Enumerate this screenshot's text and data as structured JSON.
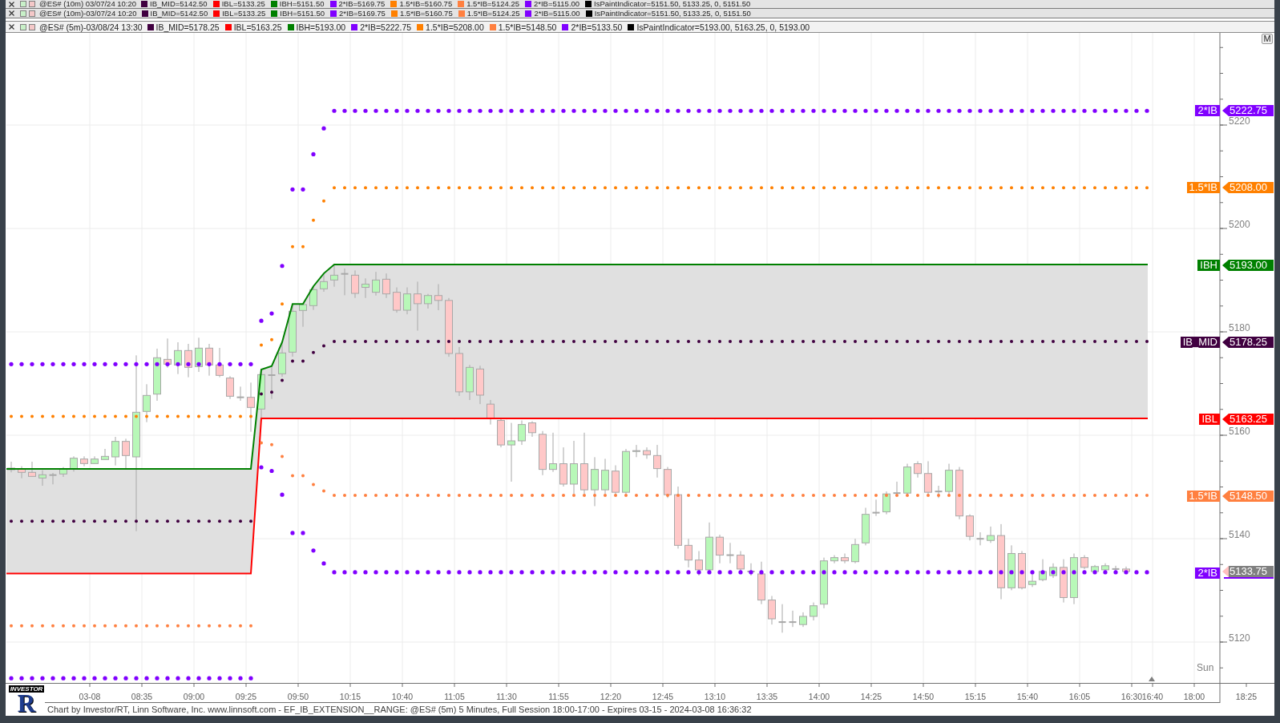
{
  "panes": [
    {
      "title": "@ES# (10m) 03/07/24 10:20",
      "legend": [
        {
          "text": "IB_MID=5142.50",
          "color": "#400040"
        },
        {
          "text": "IBL=5133.25",
          "color": "#ff0000"
        },
        {
          "text": "IBH=5151.50",
          "color": "#008000"
        },
        {
          "text": "2*IB=5169.75",
          "color": "#8000ff"
        },
        {
          "text": "1.5*IB=5160.75",
          "color": "#ff8000"
        },
        {
          "text": "1.5*IB=5124.25",
          "color": "#ff8040"
        },
        {
          "text": "2*IB=5115.00",
          "color": "#8000ff"
        },
        {
          "text": "IsPaintIndicator=5151.50, 5133.25, 0, 5151.50",
          "color": "#000000"
        }
      ]
    },
    {
      "title": "@ES# (10m)-03/07/24 10:20",
      "legend": [
        {
          "text": "IB_MID=5142.50",
          "color": "#400040"
        },
        {
          "text": "IBL=5133.25",
          "color": "#ff0000"
        },
        {
          "text": "IBH=5151.50",
          "color": "#008000"
        },
        {
          "text": "2*IB=5169.75",
          "color": "#8000ff"
        },
        {
          "text": "1.5*IB=5160.75",
          "color": "#ff8000"
        },
        {
          "text": "1.5*IB=5124.25",
          "color": "#ff8040"
        },
        {
          "text": "2*IB=5115.00",
          "color": "#8000ff"
        },
        {
          "text": "IsPaintIndicator=5151.50, 5133.25, 0, 5151.50",
          "color": "#000000"
        }
      ]
    }
  ],
  "chart": {
    "title": "@ES# (5m)-03/08/24 13:30",
    "legend": [
      {
        "text": "IB_MID=5178.25",
        "color": "#400040"
      },
      {
        "text": "IBL=5163.25",
        "color": "#ff0000"
      },
      {
        "text": "IBH=5193.00",
        "color": "#008000"
      },
      {
        "text": "2*IB=5222.75",
        "color": "#8000ff"
      },
      {
        "text": "1.5*IB=5208.00",
        "color": "#ff8000"
      },
      {
        "text": "1.5*IB=5148.50",
        "color": "#ff8040"
      },
      {
        "text": "2*IB=5133.50",
        "color": "#8000ff"
      },
      {
        "text": "IsPaintIndicator=5193.00, 5163.25, 0, 5193.00",
        "color": "#000000"
      }
    ],
    "axis_button": "M",
    "session_label": "Sun"
  },
  "price_axis": {
    "labels": [
      "5220",
      "5200",
      "5180",
      "5160",
      "5140",
      "5120"
    ]
  },
  "price_markers": [
    {
      "label": "2*IB",
      "value": "5222.75",
      "color": "#8000ff"
    },
    {
      "label": "1.5*IB",
      "value": "5208.00",
      "color": "#ff8000"
    },
    {
      "label": "IBH",
      "value": "5193.00",
      "color": "#008000"
    },
    {
      "label": "IB_MID",
      "value": "5178.25",
      "color": "#400040"
    },
    {
      "label": "IBL",
      "value": "5163.25",
      "color": "#ff0000"
    },
    {
      "label": "1.5*IB",
      "value": "5148.50",
      "color": "#ff8040"
    },
    {
      "label": "2*IB",
      "color": "#8000ff"
    }
  ],
  "last_price": {
    "value": "5133.75"
  },
  "time_axis": {
    "labels": [
      "03-08",
      "08:35",
      "09:00",
      "09:25",
      "09:50",
      "10:15",
      "10:40",
      "11:05",
      "11:30",
      "11:55",
      "12:20",
      "12:45",
      "13:10",
      "13:35",
      "14:00",
      "14:25",
      "14:50",
      "15:15",
      "15:40",
      "16:05",
      "16:30",
      "16:40",
      "18:00",
      "18:25"
    ]
  },
  "footer": {
    "logo": {
      "letter": "R",
      "band": "INVESTOR"
    },
    "text": "Chart by Investor/RT, Linn Software, Inc. www.linnsoft.com - EF_IB_EXTENSION__RANGE: @ES# (5m) 5 Minutes, Full Session 18:00-17:00 - Expires 03-15 - 2024-03-08 16:36:32"
  }
}
